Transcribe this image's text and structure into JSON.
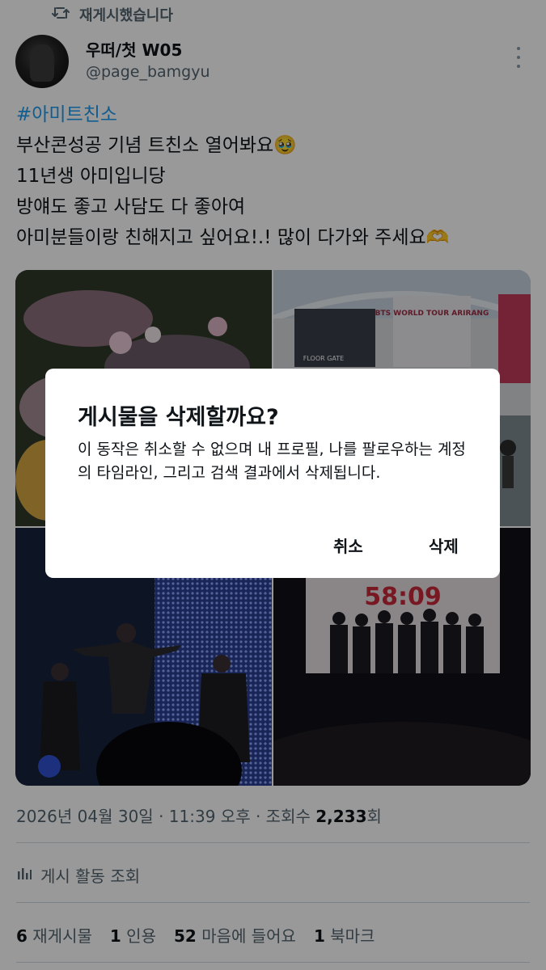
{
  "repost_text": "재게시했습니다",
  "author": {
    "display_name": "우떠/첫 W05",
    "handle": "@page_bamgyu"
  },
  "tweet": {
    "hashtag": "#아미트친소",
    "lines": [
      "부산콘성공 기념 트친소 열어봐요🥹",
      "11년생 아미입니당",
      "방얘도 좋고 사담도 다 좋아여",
      "아미분들이랑 친해지고 싶어요!.! 많이 다가와 주세요🫶"
    ]
  },
  "media": {
    "img2_sign": "BTS WORLD TOUR ARIRANG",
    "img2_floor_gate": "FLOOR GATE",
    "img4_countdown": "58:09"
  },
  "dialog": {
    "title": "게시물을 삭제할까요?",
    "body": "이 동작은 취소할 수 없으며 내 프로필, 나를 팔로우하는 계정의 타임라인, 그리고 검색 결과에서 삭제됩니다.",
    "cancel_label": "취소",
    "delete_label": "삭제"
  },
  "meta": {
    "date": "2026년 04월 30일",
    "sep1": "·",
    "time": "11:39 오후",
    "sep2": "·",
    "views_label": "조회수",
    "views_count": "2,233",
    "views_suffix": "회"
  },
  "activity_label": "게시 활동 조회",
  "stats": {
    "reposts_count": "6",
    "reposts_label": "재게시물",
    "quotes_count": "1",
    "quotes_label": "인용",
    "likes_count": "52",
    "likes_label": "마음에 들어요",
    "bookmarks_count": "1",
    "bookmarks_label": "북마크"
  },
  "colors": {
    "link": "#1d9bf0",
    "secondary_text": "#536471",
    "primary_text": "#0f1419",
    "divider": "#cfd9de",
    "overlay": "rgba(0,0,0,0.40)"
  },
  "icons": [
    "repost-icon",
    "more-icon",
    "activity-chart-icon"
  ]
}
